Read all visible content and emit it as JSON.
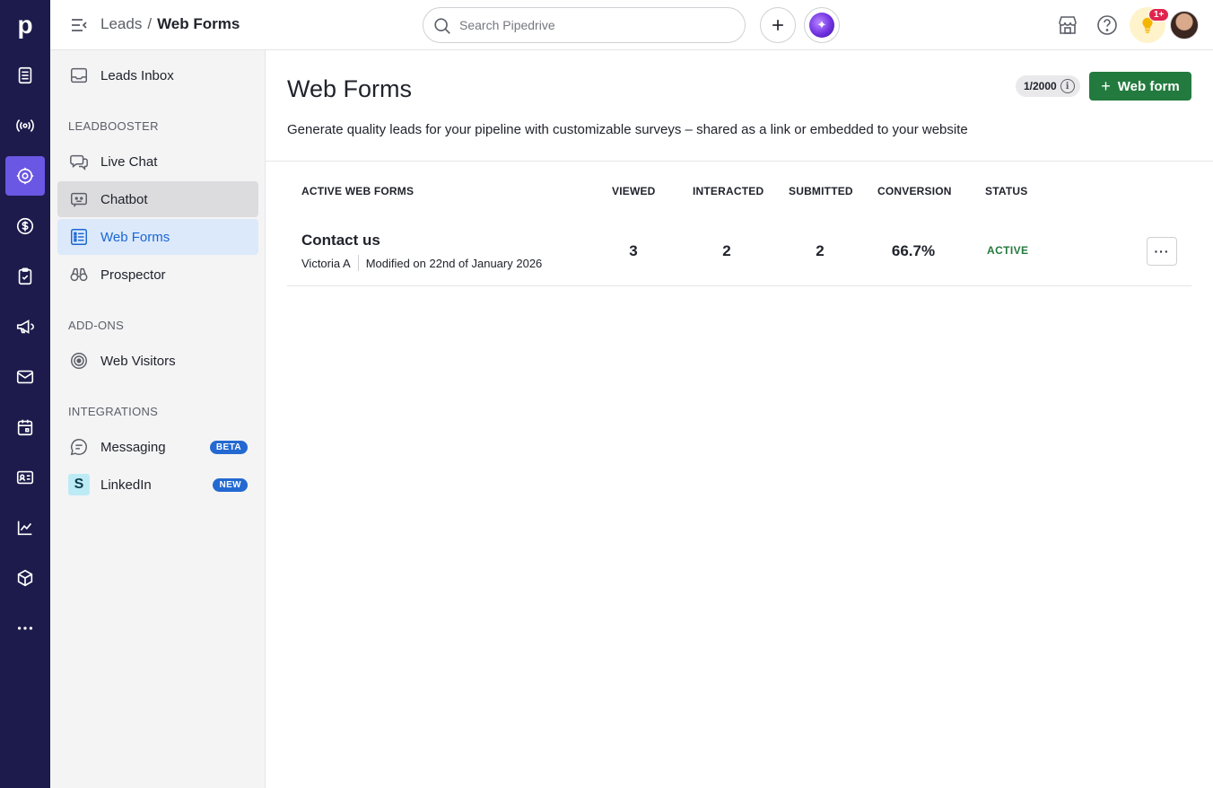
{
  "app": {
    "logo_letter": "p"
  },
  "rail": {
    "items": [
      {
        "icon": "leads-list-icon"
      },
      {
        "icon": "broadcast-icon"
      },
      {
        "icon": "leads-target-icon",
        "active": true
      },
      {
        "icon": "dollar-icon"
      },
      {
        "icon": "tasks-clipboard-icon"
      },
      {
        "icon": "megaphone-icon"
      },
      {
        "icon": "mail-icon"
      },
      {
        "icon": "calendar-icon"
      },
      {
        "icon": "contacts-card-icon"
      },
      {
        "icon": "insights-chart-icon"
      },
      {
        "icon": "products-box-icon"
      },
      {
        "icon": "more-dots-icon"
      }
    ]
  },
  "topbar": {
    "breadcrumb_parent": "Leads",
    "breadcrumb_separator": "/",
    "breadcrumb_current": "Web Forms",
    "search_placeholder": "Search Pipedrive",
    "notification_count": "1+"
  },
  "sidebar": {
    "inbox_label": "Leads Inbox",
    "section_leadbooster": "LEADBOOSTER",
    "live_chat": "Live Chat",
    "chatbot": "Chatbot",
    "web_forms": "Web Forms",
    "prospector": "Prospector",
    "section_addons": "ADD-ONS",
    "web_visitors": "Web Visitors",
    "section_integrations": "INTEGRATIONS",
    "messaging": "Messaging",
    "messaging_badge": "BETA",
    "linkedin": "LinkedIn",
    "linkedin_badge": "NEW",
    "linkedin_icon_letter": "S"
  },
  "main": {
    "title": "Web Forms",
    "quota": "1/2000",
    "add_button": "Web form",
    "subtitle": "Generate quality leads for your pipeline with customizable surveys – shared as a link or embedded to your website",
    "columns": {
      "name": "ACTIVE WEB FORMS",
      "viewed": "VIEWED",
      "interacted": "INTERACTED",
      "submitted": "SUBMITTED",
      "conversion": "CONVERSION",
      "status": "STATUS"
    },
    "rows": [
      {
        "name": "Contact us",
        "owner": "Victoria A",
        "modified": "Modified on 22nd of January 2026",
        "viewed": "3",
        "interacted": "2",
        "submitted": "2",
        "conversion": "66.7%",
        "status": "ACTIVE"
      }
    ]
  },
  "colors": {
    "rail_bg": "#1c1b4b",
    "rail_active": "#6a57e3",
    "primary_green": "#237a3e",
    "active_nav_bg": "#dce9fb",
    "active_nav_text": "#1a66d2"
  }
}
